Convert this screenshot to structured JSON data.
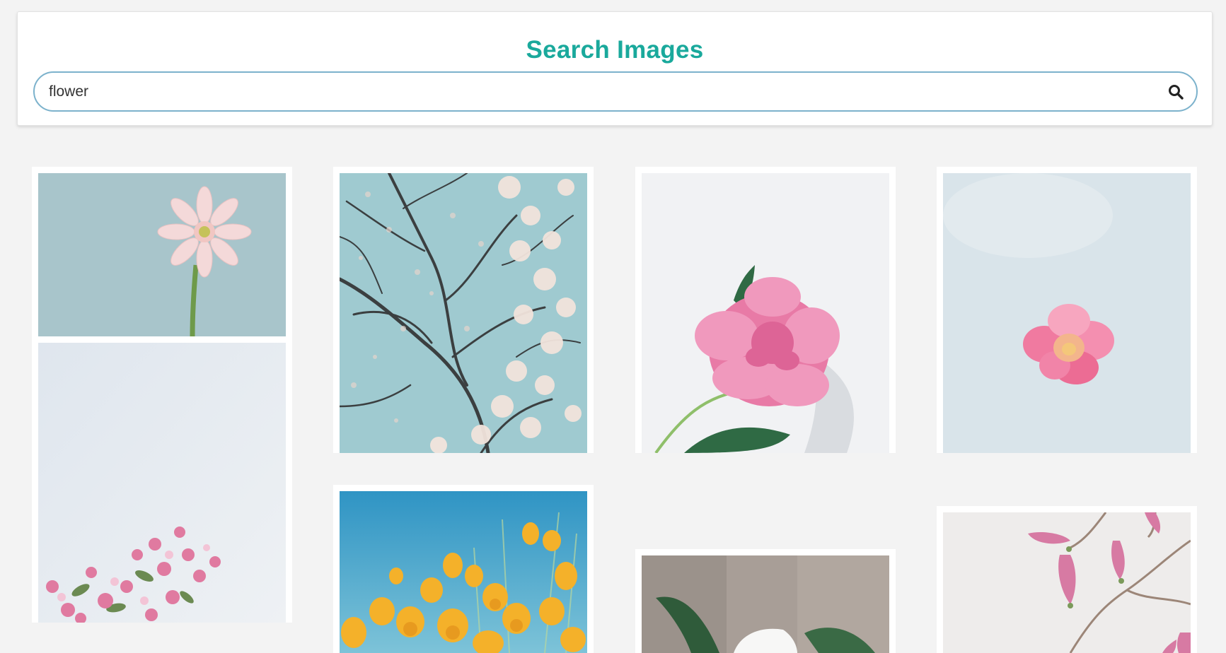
{
  "header": {
    "title": "Search Images"
  },
  "search": {
    "value": "flower",
    "icon": "search-icon"
  },
  "results": [
    {
      "name": "pink-gerbera-on-blue"
    },
    {
      "name": "magnolia-tree-branches"
    },
    {
      "name": "pink-peony-on-white"
    },
    {
      "name": "pink-rose-on-pale-blue"
    },
    {
      "name": "pink-blossoms-pale-sky"
    },
    {
      "name": "yellow-poppies-blue-sky"
    },
    {
      "name": "white-flower-leaves"
    },
    {
      "name": "pink-magnolia-buds"
    }
  ],
  "colors": {
    "accent": "#1aa99c",
    "input_border": "#7cb2cc",
    "background": "#f3f3f3"
  }
}
